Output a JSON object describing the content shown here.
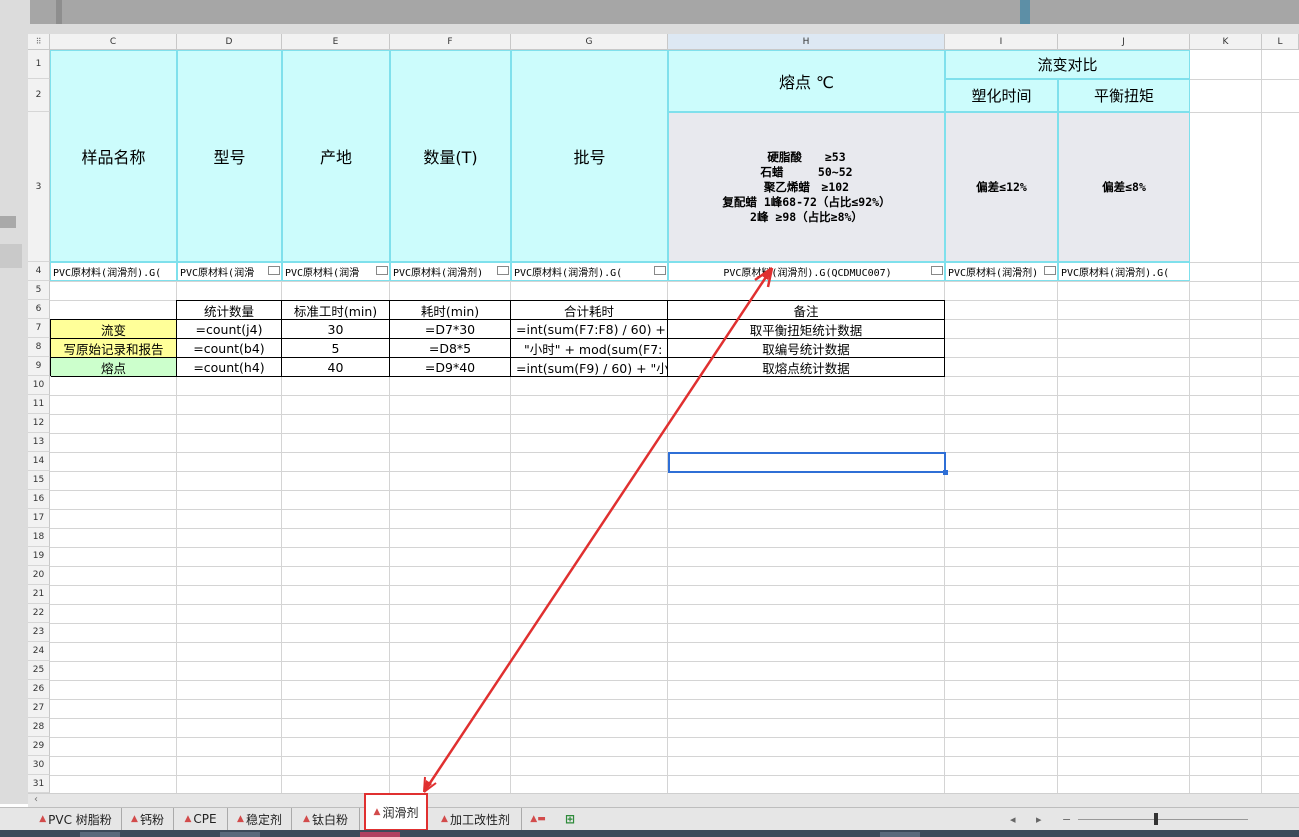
{
  "columns": [
    "C",
    "D",
    "E",
    "F",
    "G",
    "H",
    "I",
    "J",
    "K",
    "L"
  ],
  "rows": [
    "1",
    "2",
    "3",
    "4",
    "5",
    "6",
    "7",
    "8",
    "9",
    "10",
    "11",
    "12",
    "13",
    "14",
    "15",
    "16",
    "17",
    "18",
    "19",
    "20",
    "21",
    "22",
    "23",
    "24",
    "25",
    "26",
    "27",
    "28",
    "29",
    "30",
    "31"
  ],
  "header": {
    "sample_name": "样品名称",
    "model": "型号",
    "origin": "产地",
    "quantity": "数量(T)",
    "batch": "批号",
    "melting_point": "熔点 ℃",
    "rheology": "流变对比",
    "plasticizing_time": "塑化时间",
    "balance_torque": "平衡扭矩",
    "melting_spec": "硬脂酸　　≥53\n石蜡　　　50~52\n聚乙烯蜡　≥102\n复配蜡 1峰68-72（占比≤92%）\n2峰 ≥98（占比≥8%）",
    "deviation_time": "偏差≤12%",
    "deviation_torque": "偏差≤8%"
  },
  "row4": {
    "c": "PVC原材料(润滑剂).G(",
    "d": "PVC原材料(润滑",
    "e": "PVC原材料(润滑",
    "f": "PVC原材料(润滑剂)",
    "g": "PVC原材料(润滑剂).G(",
    "h": "PVC原材料(润滑剂).G(QCDMUC007)",
    "i": "PVC原材料(润滑剂)",
    "j": "PVC原材料(润滑剂).G("
  },
  "table": {
    "headers": [
      "统计数量",
      "标准工时(min)",
      "耗时(min)",
      "合计耗时",
      "备注"
    ],
    "rows": [
      {
        "name": "流变",
        "count": "=count(j4)",
        "std": "30",
        "time": "=D7*30",
        "total": "=int(sum(F7:F8) / 60) +",
        "note": "取平衡扭矩统计数据"
      },
      {
        "name": "写原始记录和报告",
        "count": "=count(b4)",
        "std": "5",
        "time": "=D8*5",
        "total": "\"小时\" + mod(sum(F7:",
        "note": "取编号统计数据"
      },
      {
        "name": "熔点",
        "count": "=count(h4)",
        "std": "40",
        "time": "=D9*40",
        "total": "=int(sum(F9) / 60) + \"小",
        "note": "取熔点统计数据"
      }
    ]
  },
  "sheet_tabs": [
    "PVC 树脂粉",
    "钙粉",
    "CPE",
    "稳定剂",
    "钛白粉",
    "润滑剂",
    "加工改性剂"
  ],
  "active_tab": "润滑剂",
  "colors": {
    "header_cyan": "#ccfcfc",
    "header_gray": "#e8e9ee",
    "yellow": "#ffff99",
    "green": "#ccffcc",
    "annotation_red": "#e03030",
    "selection_blue": "#2f6fd6"
  }
}
